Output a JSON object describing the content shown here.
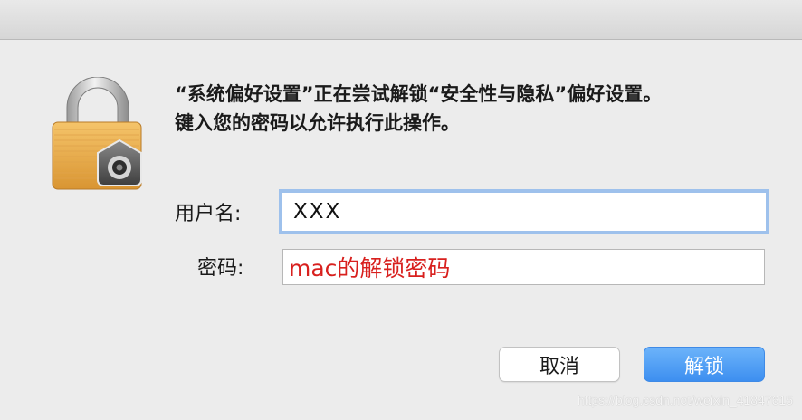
{
  "dialog": {
    "message_line1": "“系统偏好设置”正在尝试解锁“安全性与隐私”偏好设置。",
    "message_line2": "键入您的密码以允许执行此操作。"
  },
  "form": {
    "username_label": "用户名:",
    "username_value": "XXX",
    "password_label": "密码:",
    "password_annotation": "mac的解锁密码"
  },
  "buttons": {
    "cancel_label": "取消",
    "unlock_label": "解锁"
  },
  "watermark": "https://blog.csdn.net/weixin_41847615",
  "icons": {
    "lock": "padlock-icon",
    "gear": "gear-icon"
  },
  "colors": {
    "accent": "#3d8ff0",
    "annotation": "#d8201e",
    "focus_ring": "#9ec1ec"
  }
}
